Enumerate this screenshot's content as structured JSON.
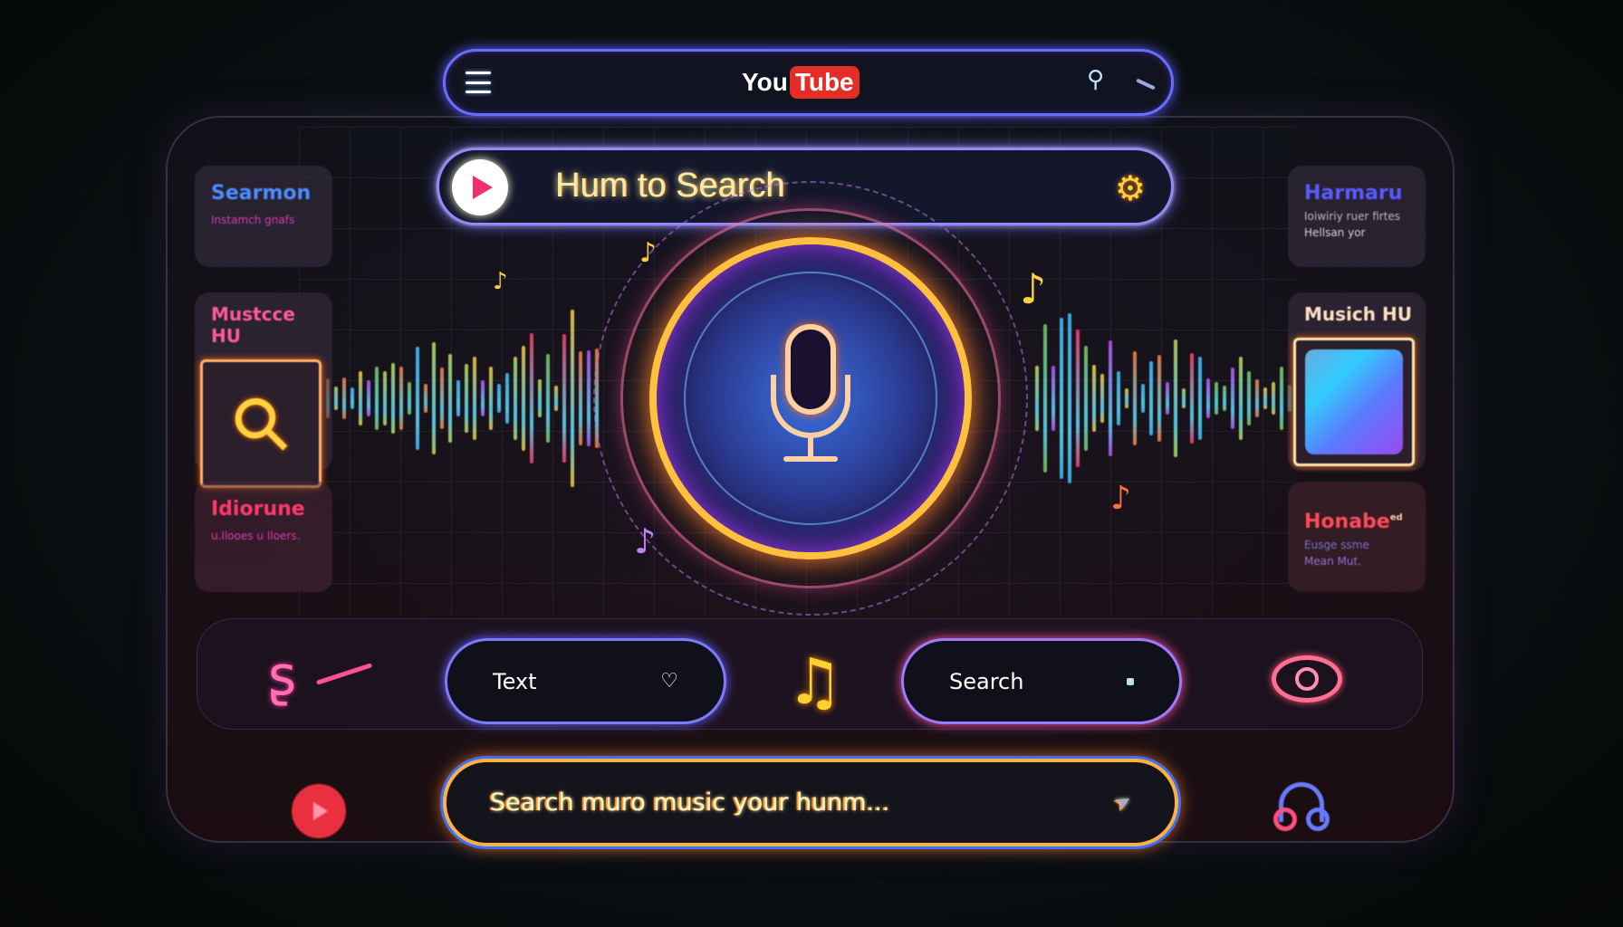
{
  "topbar": {
    "logo_you": "You",
    "logo_tube": "Tube",
    "menu_icon": "hamburger-icon",
    "search_icon": "search-icon"
  },
  "hum_bar": {
    "title": "Hum to Search",
    "settings_icon": "gear-icon"
  },
  "left_cards": [
    {
      "title": "Searmon",
      "subtitle": "Instamch gnafs",
      "color": "#4a8cff"
    },
    {
      "title": "Mustcce HU",
      "icon": "search-icon",
      "color": "#ff5a9a"
    },
    {
      "title": "Idiorune",
      "subtitle": "u.Ilooes u Iloers.",
      "color": "#ff3a6a"
    }
  ],
  "right_cards": [
    {
      "title": "Harmaru",
      "subtitle": "Ioiwiriy ruer firtes",
      "subtitle2": "Hellsan yor",
      "color": "#5a5aff"
    },
    {
      "title": "Musich HU",
      "color": "#ffe0c0"
    },
    {
      "title": "Honabe",
      "badge": "ed",
      "subtitle": "Eusge ssme",
      "subtitle2": "Mean Mut.",
      "color": "#ff4a5a"
    }
  ],
  "controls": {
    "text_label": "Text",
    "heart_icon": "heart-icon",
    "note_icon": "music-note-icon",
    "search_label": "Search",
    "left_icon": "hook-icon",
    "right_icon": "eye-icon"
  },
  "bottom_search": {
    "placeholder": "Search muro music your hunm...",
    "cursor_icon": "cursor-icon"
  },
  "footer_icons": {
    "left": "play-icon",
    "right": "headphones-icon"
  },
  "colors": {
    "accent": "#7a7cff",
    "youtube_red": "#e52d27",
    "glow_orange": "#ffb040"
  }
}
